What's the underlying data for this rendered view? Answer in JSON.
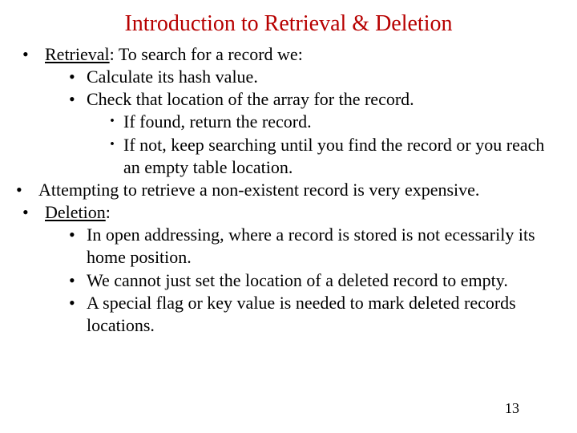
{
  "title": "Introduction to Retrieval & Deletion",
  "b1": {
    "label": "Retrieval",
    "after": ": To search for a record we:"
  },
  "b1s": {
    "a": "Calculate its hash value.",
    "b": "Check that location of the array for the record.",
    "b1": "If found, return the record.",
    "b2": "If not, keep searching until you find the record or  you reach an empty table location."
  },
  "b2": "Attempting to retrieve a non-existent record is very expensive.",
  "b3": {
    "label": "Deletion",
    "after": ":"
  },
  "b3s": {
    "a": "In open addressing, where a record is stored is not ecessarily its home position.",
    "b": "We cannot just set the location of a deleted record to empty.",
    "c": "A special flag or key value is needed to mark deleted records locations."
  },
  "page": "13"
}
